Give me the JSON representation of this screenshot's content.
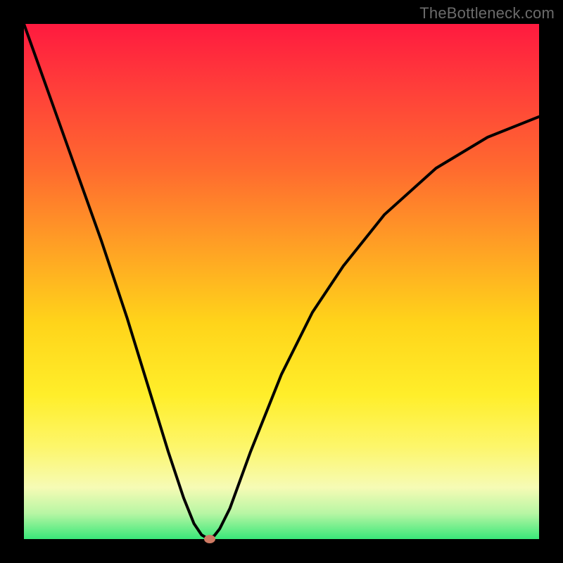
{
  "watermark": "TheBottleneck.com",
  "colors": {
    "frame": "#000000",
    "gradient_top": "#ff1a3f",
    "gradient_bottom": "#39e879",
    "curve": "#000000",
    "marker": "#cf7a63"
  },
  "chart_data": {
    "type": "line",
    "title": "",
    "xlabel": "",
    "ylabel": "",
    "xlim": [
      0,
      100
    ],
    "ylim": [
      0,
      100
    ],
    "series": [
      {
        "name": "bottleneck-curve",
        "x": [
          0,
          5,
          10,
          15,
          20,
          24,
          28,
          31,
          33,
          34.5,
          35.5,
          36,
          37,
          38,
          40,
          44,
          50,
          56,
          62,
          70,
          80,
          90,
          100
        ],
        "y": [
          100,
          86,
          72,
          58,
          43,
          30,
          17,
          8,
          3,
          0.8,
          0.2,
          0,
          0.7,
          2,
          6,
          17,
          32,
          44,
          53,
          63,
          72,
          78,
          82
        ]
      }
    ],
    "marker": {
      "x": 36,
      "y": 0
    },
    "annotations": []
  }
}
